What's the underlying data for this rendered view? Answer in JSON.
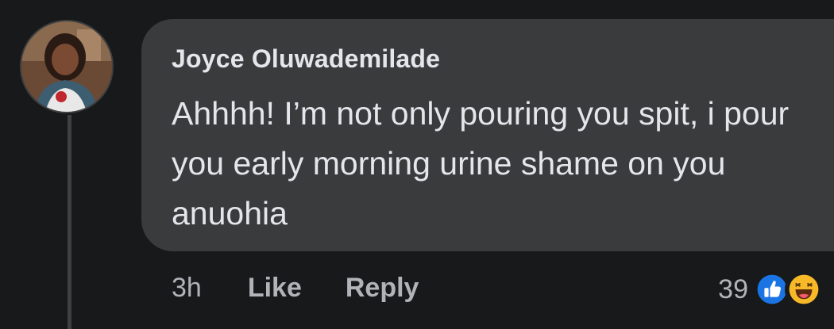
{
  "comment": {
    "author": "Joyce Oluwademilade",
    "text": "Ahhhh! I’m not only pouring you spit, i pour you early morning urine shame on you anuohia",
    "avatar_alt": "profile-photo"
  },
  "actions": {
    "time": "3h",
    "like_label": "Like",
    "reply_label": "Reply"
  },
  "reactions": {
    "count": "39",
    "icons": [
      "like-reaction-icon",
      "haha-reaction-icon"
    ],
    "colors": {
      "like": "#1b74e4",
      "haha": "#f7b928"
    }
  },
  "colors": {
    "background": "#18191a",
    "bubble": "#3a3b3c",
    "primary_text": "#e4e6eb",
    "secondary_text": "#b0b3b8"
  }
}
